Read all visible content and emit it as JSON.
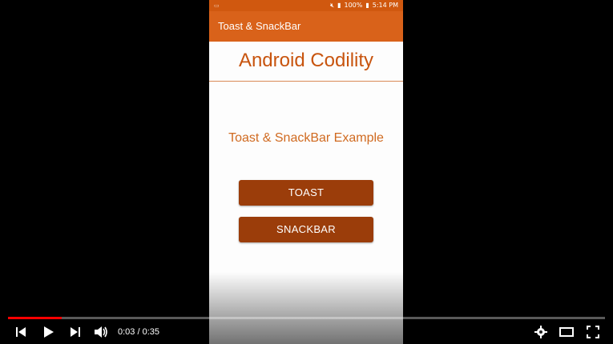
{
  "status_bar": {
    "battery": "100%",
    "time": "5:14 PM"
  },
  "app": {
    "title": "Toast & SnackBar",
    "headline": "Android Codility",
    "subtitle": "Toast & SnackBar Example",
    "buttons": {
      "toast": "TOAST",
      "snackbar": "SNACKBAR"
    }
  },
  "player": {
    "current_time": "0:03",
    "separator": " / ",
    "duration": "0:35",
    "progress_fraction": 0.09
  },
  "colors": {
    "app_bar": "#d9621a",
    "button": "#9b3d0a",
    "headline": "#c8540e",
    "progress": "#ff0000"
  },
  "icons": {
    "prev": "skip-previous-icon",
    "play": "play-icon",
    "next": "skip-next-icon",
    "volume": "volume-icon",
    "settings": "gear-icon",
    "theater": "theater-mode-icon",
    "fullscreen": "fullscreen-icon"
  }
}
